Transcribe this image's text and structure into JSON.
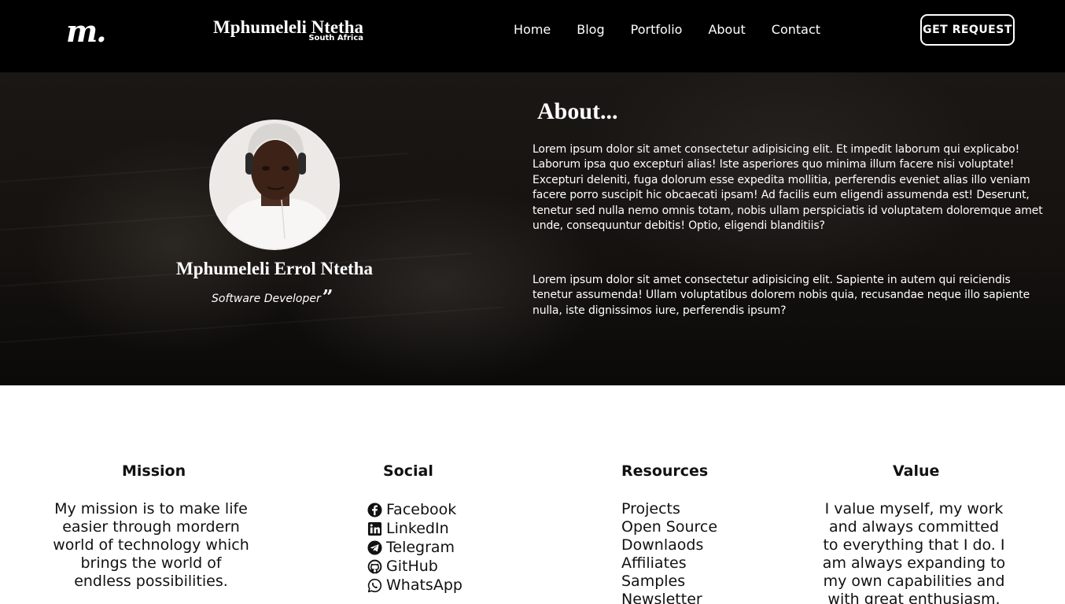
{
  "nav": {
    "logo_text": "m.",
    "brand_name": "Mphumeleli Ntetha",
    "brand_location": "South Africa",
    "links": [
      "Home",
      "Blog",
      "Portfolio",
      "About",
      "Contact"
    ],
    "cta_label": "GET REQUEST"
  },
  "hero": {
    "name": "Mphumeleli Errol Ntetha",
    "role": "Software Developer",
    "about_title": "About...",
    "paragraphs": [
      "Lorem ipsum dolor sit amet consectetur adipisicing elit. Et impedit laborum qui explicabo! Laborum ipsa quo excepturi alias! Iste asperiores quo minima illum facere nisi voluptate! Excepturi deleniti, fuga dolorum esse expedita mollitia, perferendis eveniet alias illo veniam facere porro suscipit hic obcaecati ipsam! Ad facilis eum eligendi assumenda est! Deserunt, tenetur sed nulla nemo omnis totam, nobis ullam perspiciatis id voluptatem doloremque amet unde, consequuntur debitis! Optio, eligendi blanditiis?",
      "Lorem ipsum dolor sit amet consectetur adipisicing elit. Sapiente in autem qui reiciendis tenetur assumenda! Ullam voluptatibus dolorem nobis quia, recusandae neque illo sapiente nulla, iste dignissimos iure, perferendis ipsum?"
    ]
  },
  "footer": {
    "mission": {
      "title": "Mission",
      "text": "My mission is to make life easier through mordern world of technology which brings the world of endless possibilities."
    },
    "social": {
      "title": "Social",
      "items": [
        {
          "label": "Facebook",
          "icon": "facebook-icon"
        },
        {
          "label": "LinkedIn",
          "icon": "linkedin-icon"
        },
        {
          "label": "Telegram",
          "icon": "telegram-icon"
        },
        {
          "label": "GitHub",
          "icon": "github-icon"
        },
        {
          "label": "WhatsApp",
          "icon": "whatsapp-icon"
        }
      ]
    },
    "resources": {
      "title": "Resources",
      "items": [
        "Projects",
        "Open Source",
        "Downlaods",
        "Affiliates",
        "Samples",
        "Newsletter"
      ]
    },
    "value": {
      "title": "Value",
      "text": "I value myself, my work and always committed to everything that I do. I am always expanding to my own capabilities and with great enthusiasm."
    }
  }
}
